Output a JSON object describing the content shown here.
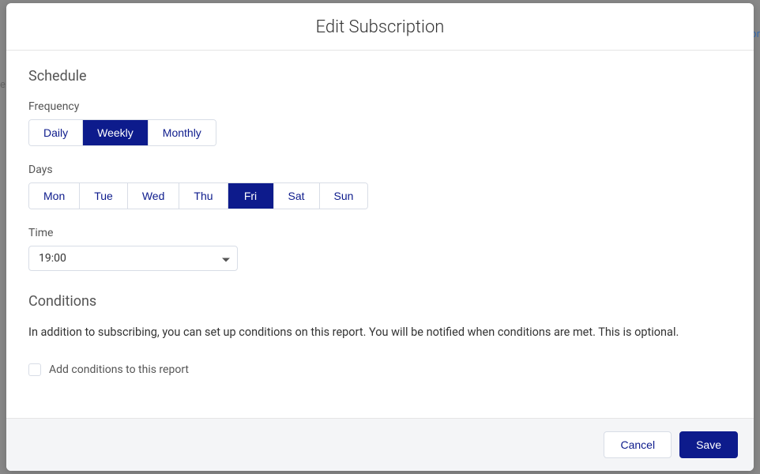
{
  "modal": {
    "title": "Edit Subscription"
  },
  "schedule": {
    "title": "Schedule",
    "frequency_label": "Frequency",
    "frequency_options": {
      "daily": "Daily",
      "weekly": "Weekly",
      "monthly": "Monthly"
    },
    "frequency_selected": "weekly",
    "days_label": "Days",
    "days": {
      "mon": "Mon",
      "tue": "Tue",
      "wed": "Wed",
      "thu": "Thu",
      "fri": "Fri",
      "sat": "Sat",
      "sun": "Sun"
    },
    "day_selected": "fri",
    "time_label": "Time",
    "time_value": "19:00"
  },
  "conditions": {
    "title": "Conditions",
    "description": "In addition to subscribing, you can set up conditions on this report. You will be notified when conditions are met. This is optional.",
    "checkbox_label": "Add conditions to this report",
    "checkbox_checked": false
  },
  "footer": {
    "cancel_label": "Cancel",
    "save_label": "Save"
  },
  "colors": {
    "brand": "#0d1b8c",
    "border": "#d8dde6",
    "footer_bg": "#f4f5f7"
  }
}
